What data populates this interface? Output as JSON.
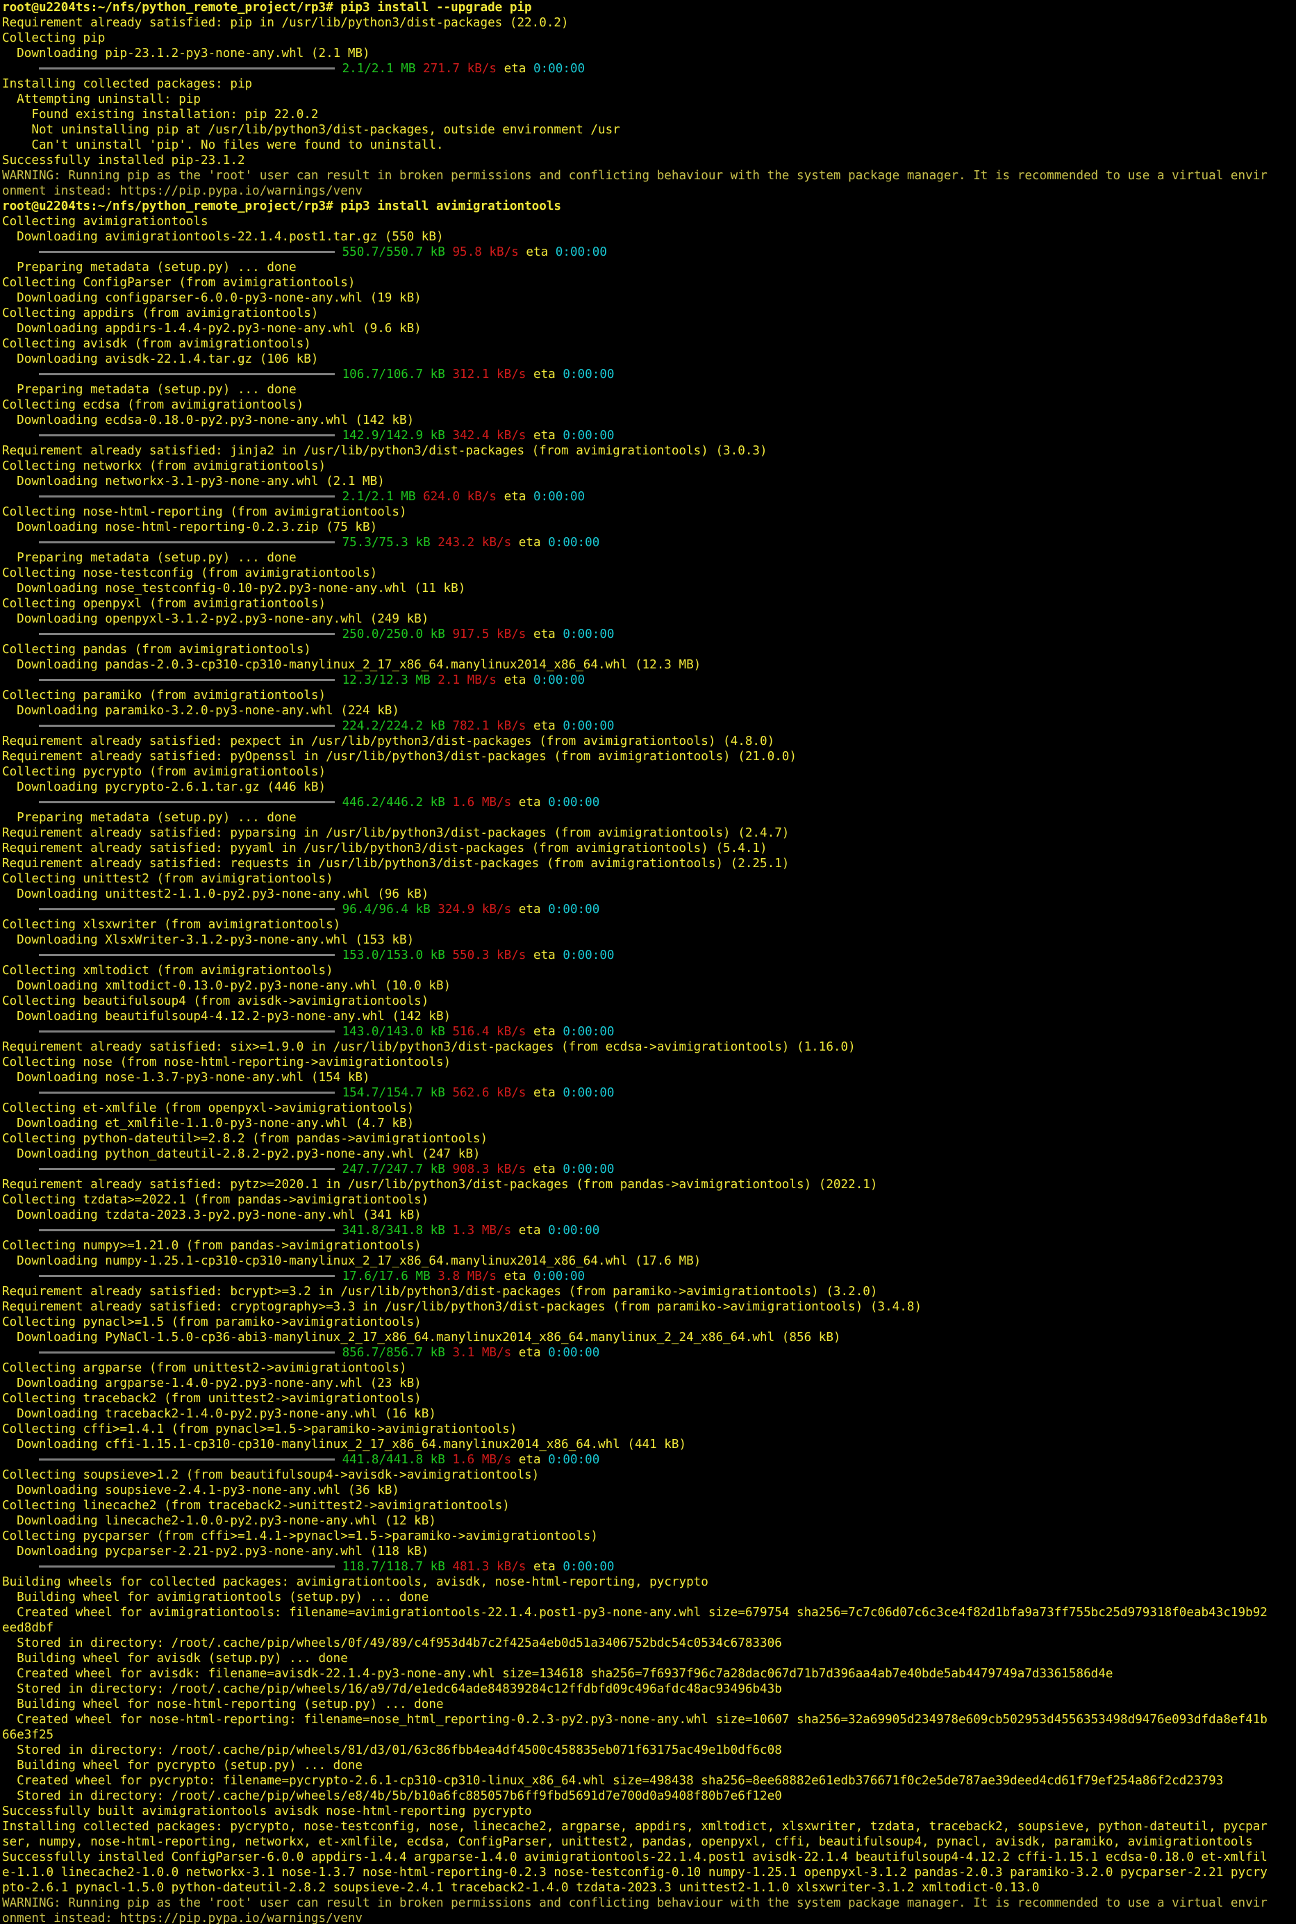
{
  "colors": {
    "background": "#000000",
    "text": "#f2e93a",
    "green": "#1fc41f",
    "red": "#d21b1b",
    "cyan": "#19c7d2",
    "bar": "#7f7f7f"
  },
  "lines": [
    {
      "type": "prompt",
      "text": "root@u2204ts:~/nfs/python_remote_project/rp3# pip3 install --upgrade pip"
    },
    {
      "type": "text",
      "text": "Requirement already satisfied: pip in /usr/lib/python3/dist-packages (22.0.2)"
    },
    {
      "type": "text",
      "text": "Collecting pip"
    },
    {
      "type": "text",
      "text": "  Downloading pip-23.1.2-py3-none-any.whl (2.1 MB)"
    },
    {
      "type": "progress",
      "size": "2.1/2.1 MB",
      "speed": "271.7 kB/s",
      "eta": "0:00:00"
    },
    {
      "type": "text",
      "text": "Installing collected packages: pip"
    },
    {
      "type": "text",
      "text": "  Attempting uninstall: pip"
    },
    {
      "type": "text",
      "text": "    Found existing installation: pip 22.0.2"
    },
    {
      "type": "text",
      "text": "    Not uninstalling pip at /usr/lib/python3/dist-packages, outside environment /usr"
    },
    {
      "type": "text",
      "text": "    Can't uninstall 'pip'. No files were found to uninstall."
    },
    {
      "type": "text",
      "text": "Successfully installed pip-23.1.2"
    },
    {
      "type": "warn",
      "text": "WARNING: Running pip as the 'root' user can result in broken permissions and conflicting behaviour with the system package manager. It is recommended to use a virtual envir"
    },
    {
      "type": "warn",
      "text": "onment instead: https://pip.pypa.io/warnings/venv"
    },
    {
      "type": "prompt",
      "text": "root@u2204ts:~/nfs/python_remote_project/rp3# pip3 install avimigrationtools"
    },
    {
      "type": "text",
      "text": "Collecting avimigrationtools"
    },
    {
      "type": "text",
      "text": "  Downloading avimigrationtools-22.1.4.post1.tar.gz (550 kB)"
    },
    {
      "type": "progress",
      "size": "550.7/550.7 kB",
      "speed": "95.8 kB/s",
      "eta": "0:00:00"
    },
    {
      "type": "text",
      "text": "  Preparing metadata (setup.py) ... done"
    },
    {
      "type": "text",
      "text": "Collecting ConfigParser (from avimigrationtools)"
    },
    {
      "type": "text",
      "text": "  Downloading configparser-6.0.0-py3-none-any.whl (19 kB)"
    },
    {
      "type": "text",
      "text": "Collecting appdirs (from avimigrationtools)"
    },
    {
      "type": "text",
      "text": "  Downloading appdirs-1.4.4-py2.py3-none-any.whl (9.6 kB)"
    },
    {
      "type": "text",
      "text": "Collecting avisdk (from avimigrationtools)"
    },
    {
      "type": "text",
      "text": "  Downloading avisdk-22.1.4.tar.gz (106 kB)"
    },
    {
      "type": "progress",
      "size": "106.7/106.7 kB",
      "speed": "312.1 kB/s",
      "eta": "0:00:00"
    },
    {
      "type": "text",
      "text": "  Preparing metadata (setup.py) ... done"
    },
    {
      "type": "text",
      "text": "Collecting ecdsa (from avimigrationtools)"
    },
    {
      "type": "text",
      "text": "  Downloading ecdsa-0.18.0-py2.py3-none-any.whl (142 kB)"
    },
    {
      "type": "progress",
      "size": "142.9/142.9 kB",
      "speed": "342.4 kB/s",
      "eta": "0:00:00"
    },
    {
      "type": "text",
      "text": "Requirement already satisfied: jinja2 in /usr/lib/python3/dist-packages (from avimigrationtools) (3.0.3)"
    },
    {
      "type": "text",
      "text": "Collecting networkx (from avimigrationtools)"
    },
    {
      "type": "text",
      "text": "  Downloading networkx-3.1-py3-none-any.whl (2.1 MB)"
    },
    {
      "type": "progress",
      "size": "2.1/2.1 MB",
      "speed": "624.0 kB/s",
      "eta": "0:00:00"
    },
    {
      "type": "text",
      "text": "Collecting nose-html-reporting (from avimigrationtools)"
    },
    {
      "type": "text",
      "text": "  Downloading nose-html-reporting-0.2.3.zip (75 kB)"
    },
    {
      "type": "progress",
      "size": "75.3/75.3 kB",
      "speed": "243.2 kB/s",
      "eta": "0:00:00"
    },
    {
      "type": "text",
      "text": "  Preparing metadata (setup.py) ... done"
    },
    {
      "type": "text",
      "text": "Collecting nose-testconfig (from avimigrationtools)"
    },
    {
      "type": "text",
      "text": "  Downloading nose_testconfig-0.10-py2.py3-none-any.whl (11 kB)"
    },
    {
      "type": "text",
      "text": "Collecting openpyxl (from avimigrationtools)"
    },
    {
      "type": "text",
      "text": "  Downloading openpyxl-3.1.2-py2.py3-none-any.whl (249 kB)"
    },
    {
      "type": "progress",
      "size": "250.0/250.0 kB",
      "speed": "917.5 kB/s",
      "eta": "0:00:00"
    },
    {
      "type": "text",
      "text": "Collecting pandas (from avimigrationtools)"
    },
    {
      "type": "text",
      "text": "  Downloading pandas-2.0.3-cp310-cp310-manylinux_2_17_x86_64.manylinux2014_x86_64.whl (12.3 MB)"
    },
    {
      "type": "progress",
      "size": "12.3/12.3 MB",
      "speed": "2.1 MB/s",
      "eta": "0:00:00"
    },
    {
      "type": "text",
      "text": "Collecting paramiko (from avimigrationtools)"
    },
    {
      "type": "text",
      "text": "  Downloading paramiko-3.2.0-py3-none-any.whl (224 kB)"
    },
    {
      "type": "progress",
      "size": "224.2/224.2 kB",
      "speed": "782.1 kB/s",
      "eta": "0:00:00"
    },
    {
      "type": "text",
      "text": "Requirement already satisfied: pexpect in /usr/lib/python3/dist-packages (from avimigrationtools) (4.8.0)"
    },
    {
      "type": "text",
      "text": "Requirement already satisfied: pyOpenssl in /usr/lib/python3/dist-packages (from avimigrationtools) (21.0.0)"
    },
    {
      "type": "text",
      "text": "Collecting pycrypto (from avimigrationtools)"
    },
    {
      "type": "text",
      "text": "  Downloading pycrypto-2.6.1.tar.gz (446 kB)"
    },
    {
      "type": "progress",
      "size": "446.2/446.2 kB",
      "speed": "1.6 MB/s",
      "eta": "0:00:00"
    },
    {
      "type": "text",
      "text": "  Preparing metadata (setup.py) ... done"
    },
    {
      "type": "text",
      "text": "Requirement already satisfied: pyparsing in /usr/lib/python3/dist-packages (from avimigrationtools) (2.4.7)"
    },
    {
      "type": "text",
      "text": "Requirement already satisfied: pyyaml in /usr/lib/python3/dist-packages (from avimigrationtools) (5.4.1)"
    },
    {
      "type": "text",
      "text": "Requirement already satisfied: requests in /usr/lib/python3/dist-packages (from avimigrationtools) (2.25.1)"
    },
    {
      "type": "text",
      "text": "Collecting unittest2 (from avimigrationtools)"
    },
    {
      "type": "text",
      "text": "  Downloading unittest2-1.1.0-py2.py3-none-any.whl (96 kB)"
    },
    {
      "type": "progress",
      "size": "96.4/96.4 kB",
      "speed": "324.9 kB/s",
      "eta": "0:00:00"
    },
    {
      "type": "text",
      "text": "Collecting xlsxwriter (from avimigrationtools)"
    },
    {
      "type": "text",
      "text": "  Downloading XlsxWriter-3.1.2-py3-none-any.whl (153 kB)"
    },
    {
      "type": "progress",
      "size": "153.0/153.0 kB",
      "speed": "550.3 kB/s",
      "eta": "0:00:00"
    },
    {
      "type": "text",
      "text": "Collecting xmltodict (from avimigrationtools)"
    },
    {
      "type": "text",
      "text": "  Downloading xmltodict-0.13.0-py2.py3-none-any.whl (10.0 kB)"
    },
    {
      "type": "text",
      "text": "Collecting beautifulsoup4 (from avisdk->avimigrationtools)"
    },
    {
      "type": "text",
      "text": "  Downloading beautifulsoup4-4.12.2-py3-none-any.whl (142 kB)"
    },
    {
      "type": "progress",
      "size": "143.0/143.0 kB",
      "speed": "516.4 kB/s",
      "eta": "0:00:00"
    },
    {
      "type": "text",
      "text": "Requirement already satisfied: six>=1.9.0 in /usr/lib/python3/dist-packages (from ecdsa->avimigrationtools) (1.16.0)"
    },
    {
      "type": "text",
      "text": "Collecting nose (from nose-html-reporting->avimigrationtools)"
    },
    {
      "type": "text",
      "text": "  Downloading nose-1.3.7-py3-none-any.whl (154 kB)"
    },
    {
      "type": "progress",
      "size": "154.7/154.7 kB",
      "speed": "562.6 kB/s",
      "eta": "0:00:00"
    },
    {
      "type": "text",
      "text": "Collecting et-xmlfile (from openpyxl->avimigrationtools)"
    },
    {
      "type": "text",
      "text": "  Downloading et_xmlfile-1.1.0-py3-none-any.whl (4.7 kB)"
    },
    {
      "type": "text",
      "text": "Collecting python-dateutil>=2.8.2 (from pandas->avimigrationtools)"
    },
    {
      "type": "text",
      "text": "  Downloading python_dateutil-2.8.2-py2.py3-none-any.whl (247 kB)"
    },
    {
      "type": "progress",
      "size": "247.7/247.7 kB",
      "speed": "908.3 kB/s",
      "eta": "0:00:00"
    },
    {
      "type": "text",
      "text": "Requirement already satisfied: pytz>=2020.1 in /usr/lib/python3/dist-packages (from pandas->avimigrationtools) (2022.1)"
    },
    {
      "type": "text",
      "text": "Collecting tzdata>=2022.1 (from pandas->avimigrationtools)"
    },
    {
      "type": "text",
      "text": "  Downloading tzdata-2023.3-py2.py3-none-any.whl (341 kB)"
    },
    {
      "type": "progress",
      "size": "341.8/341.8 kB",
      "speed": "1.3 MB/s",
      "eta": "0:00:00"
    },
    {
      "type": "text",
      "text": "Collecting numpy>=1.21.0 (from pandas->avimigrationtools)"
    },
    {
      "type": "text",
      "text": "  Downloading numpy-1.25.1-cp310-cp310-manylinux_2_17_x86_64.manylinux2014_x86_64.whl (17.6 MB)"
    },
    {
      "type": "progress",
      "size": "17.6/17.6 MB",
      "speed": "3.8 MB/s",
      "eta": "0:00:00"
    },
    {
      "type": "text",
      "text": "Requirement already satisfied: bcrypt>=3.2 in /usr/lib/python3/dist-packages (from paramiko->avimigrationtools) (3.2.0)"
    },
    {
      "type": "text",
      "text": "Requirement already satisfied: cryptography>=3.3 in /usr/lib/python3/dist-packages (from paramiko->avimigrationtools) (3.4.8)"
    },
    {
      "type": "text",
      "text": "Collecting pynacl>=1.5 (from paramiko->avimigrationtools)"
    },
    {
      "type": "text",
      "text": "  Downloading PyNaCl-1.5.0-cp36-abi3-manylinux_2_17_x86_64.manylinux2014_x86_64.manylinux_2_24_x86_64.whl (856 kB)"
    },
    {
      "type": "progress",
      "size": "856.7/856.7 kB",
      "speed": "3.1 MB/s",
      "eta": "0:00:00"
    },
    {
      "type": "text",
      "text": "Collecting argparse (from unittest2->avimigrationtools)"
    },
    {
      "type": "text",
      "text": "  Downloading argparse-1.4.0-py2.py3-none-any.whl (23 kB)"
    },
    {
      "type": "text",
      "text": "Collecting traceback2 (from unittest2->avimigrationtools)"
    },
    {
      "type": "text",
      "text": "  Downloading traceback2-1.4.0-py2.py3-none-any.whl (16 kB)"
    },
    {
      "type": "text",
      "text": "Collecting cffi>=1.4.1 (from pynacl>=1.5->paramiko->avimigrationtools)"
    },
    {
      "type": "text",
      "text": "  Downloading cffi-1.15.1-cp310-cp310-manylinux_2_17_x86_64.manylinux2014_x86_64.whl (441 kB)"
    },
    {
      "type": "progress",
      "size": "441.8/441.8 kB",
      "speed": "1.6 MB/s",
      "eta": "0:00:00"
    },
    {
      "type": "text",
      "text": "Collecting soupsieve>1.2 (from beautifulsoup4->avisdk->avimigrationtools)"
    },
    {
      "type": "text",
      "text": "  Downloading soupsieve-2.4.1-py3-none-any.whl (36 kB)"
    },
    {
      "type": "text",
      "text": "Collecting linecache2 (from traceback2->unittest2->avimigrationtools)"
    },
    {
      "type": "text",
      "text": "  Downloading linecache2-1.0.0-py2.py3-none-any.whl (12 kB)"
    },
    {
      "type": "text",
      "text": "Collecting pycparser (from cffi>=1.4.1->pynacl>=1.5->paramiko->avimigrationtools)"
    },
    {
      "type": "text",
      "text": "  Downloading pycparser-2.21-py2.py3-none-any.whl (118 kB)"
    },
    {
      "type": "progress",
      "size": "118.7/118.7 kB",
      "speed": "481.3 kB/s",
      "eta": "0:00:00"
    },
    {
      "type": "text",
      "text": "Building wheels for collected packages: avimigrationtools, avisdk, nose-html-reporting, pycrypto"
    },
    {
      "type": "text",
      "text": "  Building wheel for avimigrationtools (setup.py) ... done"
    },
    {
      "type": "text",
      "text": "  Created wheel for avimigrationtools: filename=avimigrationtools-22.1.4.post1-py3-none-any.whl size=679754 sha256=7c7c06d07c6c3ce4f82d1bfa9a73ff755bc25d979318f0eab43c19b92"
    },
    {
      "type": "text",
      "text": "eed8dbf"
    },
    {
      "type": "text",
      "text": "  Stored in directory: /root/.cache/pip/wheels/0f/49/89/c4f953d4b7c2f425a4eb0d51a3406752bdc54c0534c6783306"
    },
    {
      "type": "text",
      "text": "  Building wheel for avisdk (setup.py) ... done"
    },
    {
      "type": "text",
      "text": "  Created wheel for avisdk: filename=avisdk-22.1.4-py3-none-any.whl size=134618 sha256=7f6937f96c7a28dac067d71b7d396aa4ab7e40bde5ab4479749a7d3361586d4e"
    },
    {
      "type": "text",
      "text": "  Stored in directory: /root/.cache/pip/wheels/16/a9/7d/e1edc64ade84839284c12ffdbfd09c496afdc48ac93496b43b"
    },
    {
      "type": "text",
      "text": "  Building wheel for nose-html-reporting (setup.py) ... done"
    },
    {
      "type": "text",
      "text": "  Created wheel for nose-html-reporting: filename=nose_html_reporting-0.2.3-py2.py3-none-any.whl size=10607 sha256=32a69905d234978e609cb502953d4556353498d9476e093dfda8ef41b"
    },
    {
      "type": "text",
      "text": "66e3f25"
    },
    {
      "type": "text",
      "text": "  Stored in directory: /root/.cache/pip/wheels/81/d3/01/63c86fbb4ea4df4500c458835eb071f63175ac49e1b0df6c08"
    },
    {
      "type": "text",
      "text": "  Building wheel for pycrypto (setup.py) ... done"
    },
    {
      "type": "text",
      "text": "  Created wheel for pycrypto: filename=pycrypto-2.6.1-cp310-cp310-linux_x86_64.whl size=498438 sha256=8ee68882e61edb376671f0c2e5de787ae39deed4cd61f79ef254a86f2cd23793"
    },
    {
      "type": "text",
      "text": "  Stored in directory: /root/.cache/pip/wheels/e8/4b/5b/b10a6fc885057b6ff9fbd5691d7e700d0a9408f80b7e6f12e0"
    },
    {
      "type": "text",
      "text": "Successfully built avimigrationtools avisdk nose-html-reporting pycrypto"
    },
    {
      "type": "text",
      "text": "Installing collected packages: pycrypto, nose-testconfig, nose, linecache2, argparse, appdirs, xmltodict, xlsxwriter, tzdata, traceback2, soupsieve, python-dateutil, pycpar"
    },
    {
      "type": "text",
      "text": "ser, numpy, nose-html-reporting, networkx, et-xmlfile, ecdsa, ConfigParser, unittest2, pandas, openpyxl, cffi, beautifulsoup4, pynacl, avisdk, paramiko, avimigrationtools"
    },
    {
      "type": "text",
      "text": "Successfully installed ConfigParser-6.0.0 appdirs-1.4.4 argparse-1.4.0 avimigrationtools-22.1.4.post1 avisdk-22.1.4 beautifulsoup4-4.12.2 cffi-1.15.1 ecdsa-0.18.0 et-xmlfil"
    },
    {
      "type": "text",
      "text": "e-1.1.0 linecache2-1.0.0 networkx-3.1 nose-1.3.7 nose-html-reporting-0.2.3 nose-testconfig-0.10 numpy-1.25.1 openpyxl-3.1.2 pandas-2.0.3 paramiko-3.2.0 pycparser-2.21 pycry"
    },
    {
      "type": "text",
      "text": "pto-2.6.1 pynacl-1.5.0 python-dateutil-2.8.2 soupsieve-2.4.1 traceback2-1.4.0 tzdata-2023.3 unittest2-1.1.0 xlsxwriter-3.1.2 xmltodict-0.13.0"
    },
    {
      "type": "warn",
      "text": "WARNING: Running pip as the 'root' user can result in broken permissions and conflicting behaviour with the system package manager. It is recommended to use a virtual envir"
    },
    {
      "type": "warn",
      "text": "onment instead: https://pip.pypa.io/warnings/venv"
    }
  ]
}
